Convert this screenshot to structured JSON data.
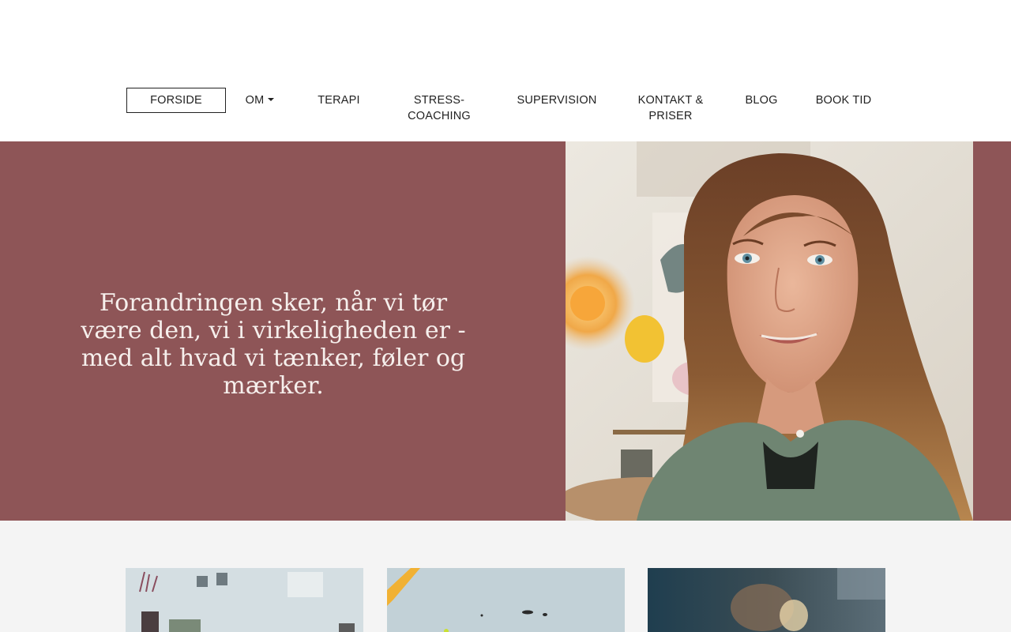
{
  "nav": {
    "items": [
      {
        "label": "FORSIDE"
      },
      {
        "label": "OM"
      },
      {
        "label": "TERAPI"
      },
      {
        "label": "STRESS-",
        "label2": "COACHING"
      },
      {
        "label": "SUPERVISION"
      },
      {
        "label": "KONTAKT &",
        "label2": "PRISER"
      },
      {
        "label": "BLOG"
      },
      {
        "label": "BOOK TID"
      }
    ]
  },
  "hero": {
    "quote": "Forandringen sker, når vi tør være den, vi i virkeligheden er - med alt hvad vi tænker, føler og mærker.",
    "background": "#8e5557"
  },
  "icons": {
    "dropdown": "caret-down-icon"
  }
}
